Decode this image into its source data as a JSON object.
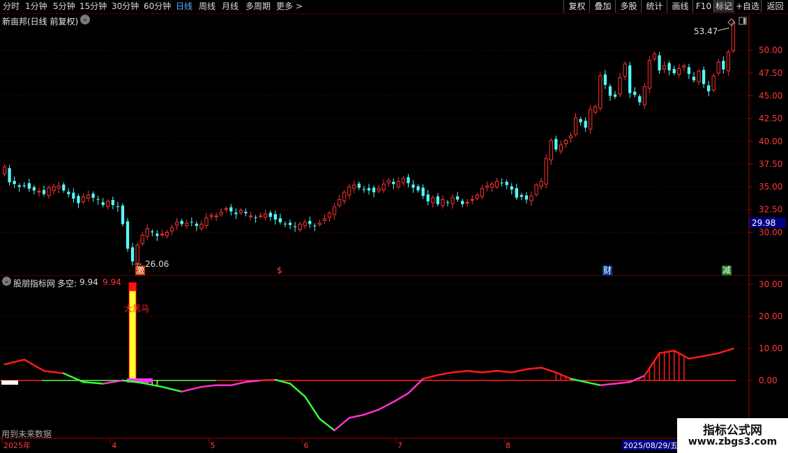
{
  "toolbar": {
    "periods": [
      "分时",
      "1分钟",
      "5分钟",
      "15分钟",
      "30分钟",
      "60分钟",
      "日线",
      "周线",
      "月线",
      "多周期",
      "更多"
    ],
    "active_period": "日线",
    "more_arrow": ">",
    "buttons": [
      "复权",
      "叠加",
      "多股",
      "统计",
      "画线",
      "F10",
      "+自选",
      "返回"
    ]
  },
  "main": {
    "stock_title": "新亩邦(日线 前复权)",
    "high_label": "53.47",
    "low_label": "26.06",
    "current_price": "29.98",
    "markers": [
      "激",
      "$",
      "财",
      "减"
    ],
    "y_ticks": [
      "50.00",
      "47.50",
      "45.00",
      "42.50",
      "40.00",
      "37.50",
      "35.00",
      "32.50",
      "30.00"
    ]
  },
  "indicator": {
    "name": "股朋指标网",
    "series_label": "多空:",
    "value1": "9.94",
    "value2": "9.94",
    "annotation": "大黑马",
    "footer_text": "用到未来数据",
    "y_ticks": [
      "30.00",
      "20.00",
      "10.00",
      "0.00"
    ]
  },
  "xaxis": {
    "labels": [
      "2025年",
      "4",
      "5",
      "6",
      "7",
      "8"
    ],
    "date_box": "2025/08/29/五"
  },
  "watermark": {
    "line1": "指标公式网",
    "line2": "www.zbgs3.com"
  },
  "colors": {
    "up": "#ff3333",
    "down": "#54ffff",
    "grid": "#7a0000",
    "active": "#5ab0ff"
  },
  "chart_data": [
    {
      "type": "candlestick",
      "title": "新亩邦(日线 前复权)",
      "ylim": [
        25.2,
        54
      ],
      "y_ticks": [
        30,
        32.5,
        35,
        37.5,
        40,
        42.5,
        45,
        47.5,
        50
      ],
      "x_month_labels": [
        "2025年",
        "4",
        "5",
        "6",
        "7",
        "8"
      ],
      "close": [
        37.2,
        35.5,
        35.3,
        35.0,
        35.1,
        34.8,
        34.6,
        34.5,
        34.2,
        34.9,
        35.0,
        35.1,
        34.6,
        34.2,
        33.7,
        33.2,
        33.9,
        34.1,
        33.8,
        33.6,
        33.0,
        33.4,
        33.0,
        32.8,
        30.9,
        28.2,
        26.8,
        28.6,
        29.7,
        30.4,
        30.0,
        29.6,
        29.8,
        30.0,
        30.5,
        31.1,
        30.9,
        31.0,
        31.1,
        30.7,
        30.9,
        31.6,
        31.9,
        31.8,
        32.2,
        32.6,
        32.3,
        32.0,
        32.4,
        32.1,
        31.8,
        31.6,
        31.8,
        32.0,
        31.7,
        31.4,
        31.1,
        30.9,
        30.8,
        30.6,
        30.9,
        31.1,
        30.9,
        30.7,
        31.0,
        31.5,
        32.1,
        32.8,
        33.6,
        34.4,
        35.0,
        35.2,
        34.9,
        34.7,
        34.6,
        34.4,
        34.8,
        35.3,
        35.7,
        35.3,
        35.6,
        35.9,
        35.4,
        34.9,
        34.6,
        34.0,
        33.4,
        33.8,
        33.1,
        33.6,
        33.3,
        33.8,
        33.6,
        33.1,
        33.3,
        33.6,
        34.1,
        34.8,
        35.1,
        35.3,
        35.6,
        35.4,
        35.2,
        34.7,
        33.8,
        33.9,
        33.6,
        34.0,
        35.2,
        35.6,
        38.1,
        40.1,
        39.1,
        39.6,
        40.1,
        40.6,
        42.6,
        42.1,
        41.5,
        43.5,
        43.8,
        47.2,
        46.2,
        45.0,
        44.9,
        47.0,
        48.5,
        45.3,
        45.1,
        44.3,
        46.0,
        48.9,
        49.6,
        47.8,
        48.3,
        47.8,
        47.5,
        48.0,
        48.3,
        47.4,
        46.7,
        47.7,
        46.3,
        45.5,
        47.2,
        48.7,
        47.9,
        49.8,
        53.0
      ],
      "high_label": 53.47,
      "low_label": 26.06
    },
    {
      "type": "line",
      "title": "股朋指标网",
      "series": [
        {
          "name": "多空",
          "last_value": 9.94
        }
      ],
      "ylim": [
        -17,
        30
      ],
      "y_ticks": [
        0,
        10,
        20,
        30
      ],
      "x": [
        0,
        4,
        8,
        12,
        16,
        20,
        24,
        28,
        32,
        36,
        40,
        43,
        46,
        49,
        52,
        55,
        58,
        61,
        64,
        67,
        70,
        73,
        76,
        79,
        82,
        85,
        88,
        91,
        94,
        97,
        100,
        103,
        106,
        109,
        112,
        115,
        118,
        121,
        124,
        127,
        130,
        133,
        136,
        139,
        142,
        145,
        148
      ],
      "values": [
        5,
        6.5,
        3,
        2.2,
        -0.5,
        -1,
        0,
        -0.8,
        -2,
        -3.5,
        -2,
        -1.5,
        -1.5,
        -0.5,
        0,
        0.2,
        -1,
        -5,
        -12,
        -15.6,
        -11.7,
        -10.7,
        -9.1,
        -6.7,
        -4,
        0.5,
        1.7,
        2.5,
        3,
        2.5,
        3,
        2.5,
        3.5,
        4,
        2.5,
        0.5,
        -0.5,
        -1.5,
        -1,
        -0.5,
        1.5,
        8.5,
        9.3,
        6.8,
        7.6,
        8.5,
        9.94
      ],
      "bar_annotation": {
        "label": "大黑马",
        "top": 30.5
      }
    }
  ]
}
